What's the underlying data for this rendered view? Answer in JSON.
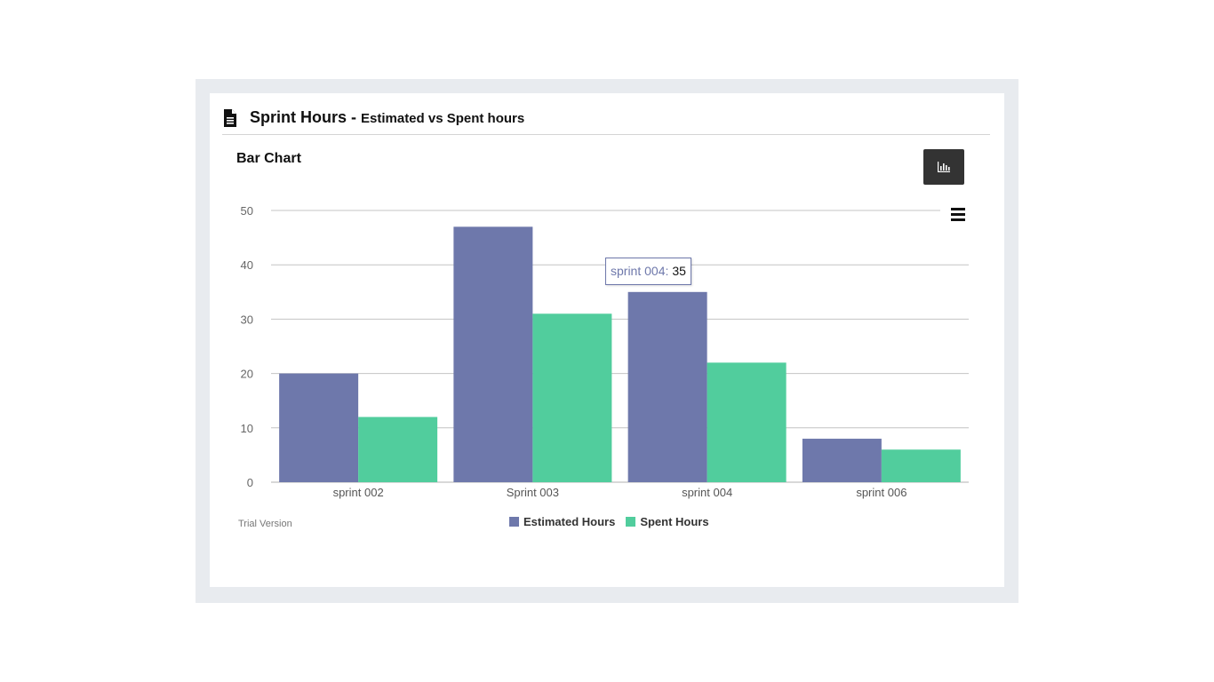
{
  "panel": {
    "title": "Sprint Hours - ",
    "subtitle": "Estimated vs Spent hours",
    "icon": "document-icon"
  },
  "chart_header": {
    "title": "Bar Chart",
    "type_button_icon": "bar-chart-icon",
    "menu_icon": "hamburger-menu-icon"
  },
  "watermark": "Trial Version",
  "tooltip": {
    "label": "sprint 004:",
    "value": "35"
  },
  "colors": {
    "estimated": "#6e78ab",
    "spent": "#51cd9d"
  },
  "chart_data": {
    "type": "bar",
    "categories": [
      "sprint 002",
      "Sprint 003",
      "sprint 004",
      "sprint 006"
    ],
    "series": [
      {
        "name": "Estimated Hours",
        "values": [
          20,
          47,
          35,
          8
        ]
      },
      {
        "name": "Spent Hours",
        "values": [
          12,
          31,
          22,
          6
        ]
      }
    ],
    "ylim": [
      0,
      50
    ],
    "yticks": [
      0,
      10,
      20,
      30,
      40,
      50
    ],
    "grid": true,
    "legend": "bottom-center"
  }
}
